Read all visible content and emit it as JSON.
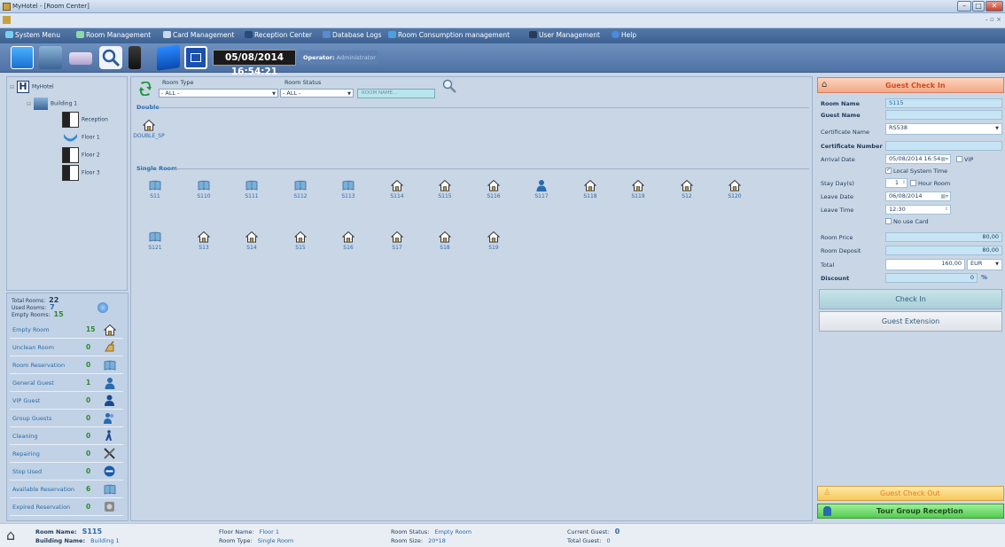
{
  "window": {
    "title": "MyHotel - [Room Center]"
  },
  "menu": [
    {
      "label": "System Menu"
    },
    {
      "label": "Room Management"
    },
    {
      "label": "Card Management"
    },
    {
      "label": "Reception Center"
    },
    {
      "label": "Database Logs"
    },
    {
      "label": "Room Consumption management"
    },
    {
      "label": "User Management"
    },
    {
      "label": "Help"
    }
  ],
  "toolbar": {
    "datetime": "05/08/2014 16:54:21",
    "operator_label": "Operator:",
    "operator_name": "Administrator"
  },
  "tree": {
    "root": "MyHotel",
    "building": "Building 1",
    "items": [
      "Reception",
      "Floor 1",
      "Floor 2",
      "Floor 3"
    ]
  },
  "summary": {
    "total_label": "Total Rooms:",
    "total": "22",
    "used_label": "Used Rooms:",
    "used": "7",
    "empty_label": "Empty Rooms:",
    "empty": "15"
  },
  "legend": [
    {
      "label": "Empty Room",
      "count": "15",
      "icon": "house-icon"
    },
    {
      "label": "Unclean Room",
      "count": "0",
      "icon": "broom-icon"
    },
    {
      "label": "Room Reservation",
      "count": "0",
      "icon": "reservation-icon"
    },
    {
      "label": "General Guest",
      "count": "1",
      "icon": "guest-icon"
    },
    {
      "label": "VIP Guest",
      "count": "0",
      "icon": "vip-guest-icon"
    },
    {
      "label": "Group Guests",
      "count": "0",
      "icon": "group-guests-icon"
    },
    {
      "label": "Cleaning",
      "count": "0",
      "icon": "cleaning-icon"
    },
    {
      "label": "Repairing",
      "count": "0",
      "icon": "tools-icon"
    },
    {
      "label": "Stop Used",
      "count": "0",
      "icon": "stop-icon"
    },
    {
      "label": "Available Reservation",
      "count": "6",
      "icon": "available-reservation-icon"
    },
    {
      "label": "Expired Reservation",
      "count": "0",
      "icon": "expired-reservation-icon"
    }
  ],
  "filters": {
    "room_type_label": "Room Type",
    "room_type_value": "- ALL -",
    "room_status_label": "Room Status",
    "room_status_value": "- ALL -",
    "search_placeholder": "ROOM NAME..."
  },
  "sections": {
    "double": "Double",
    "single": "Single Room"
  },
  "double_rooms": [
    {
      "name": "DOUBLE_SP",
      "status": "empty"
    }
  ],
  "single_rooms": [
    {
      "name": "S11",
      "status": "reserved"
    },
    {
      "name": "S110",
      "status": "reserved"
    },
    {
      "name": "S111",
      "status": "reserved"
    },
    {
      "name": "S112",
      "status": "reserved"
    },
    {
      "name": "S113",
      "status": "reserved"
    },
    {
      "name": "S114",
      "status": "empty"
    },
    {
      "name": "S115",
      "status": "empty"
    },
    {
      "name": "S116",
      "status": "empty"
    },
    {
      "name": "S117",
      "status": "guest"
    },
    {
      "name": "S118",
      "status": "empty"
    },
    {
      "name": "S119",
      "status": "empty"
    },
    {
      "name": "S12",
      "status": "empty"
    },
    {
      "name": "S120",
      "status": "empty"
    },
    {
      "name": "S121",
      "status": "reserved"
    },
    {
      "name": "S13",
      "status": "empty"
    },
    {
      "name": "S14",
      "status": "empty"
    },
    {
      "name": "S15",
      "status": "empty"
    },
    {
      "name": "S16",
      "status": "empty"
    },
    {
      "name": "S17",
      "status": "empty"
    },
    {
      "name": "S18",
      "status": "empty"
    },
    {
      "name": "S19",
      "status": "empty"
    }
  ],
  "checkin": {
    "title": "Guest Check In",
    "room_name_label": "Room Name",
    "room_name": "S115",
    "guest_name_label": "Guest Name",
    "guest_name": "",
    "certificate_name_label": "Certificate Name",
    "certificate_name": "RS538",
    "certificate_number_label": "Certificate Number",
    "certificate_number": "",
    "arrival_label": "Arrival Date",
    "arrival": "05/08/2014 16:54",
    "vip_label": "VIP",
    "local_time_label": "Local System Time",
    "stay_label": "Stay Day(s)",
    "stay": "1",
    "hour_room_label": "Hour Room",
    "leave_date_label": "Leave Date",
    "leave_date": "06/08/2014",
    "leave_time_label": "Leave Time",
    "leave_time": "12:30",
    "no_card_label": "No use Card",
    "price_label": "Room Price",
    "price": "80,00",
    "deposit_label": "Room Deposit",
    "deposit": "80,00",
    "total_label": "Total",
    "total": "160,00",
    "currency": "EUR",
    "discount_label": "Discount",
    "discount": "0",
    "discount_unit": "%",
    "checkin_button": "Check In",
    "extension_button": "Guest Extension"
  },
  "checkout": {
    "title": "Guest Check Out"
  },
  "tour": {
    "title": "Tour Group Reception"
  },
  "status": {
    "room_name_label": "Room Name:",
    "room_name": "S115",
    "building_label": "Building Name:",
    "building": "Building 1",
    "floor_label": "Floor Name:",
    "floor": "Floor 1",
    "type_label": "Room Type:",
    "type": "Single Room",
    "status_label": "Room Status:",
    "status": "Empty Room",
    "size_label": "Room Size:",
    "size": "20*18",
    "current_label": "Current Guest:",
    "current": "0",
    "total_label": "Total Guest:",
    "total": "0"
  }
}
